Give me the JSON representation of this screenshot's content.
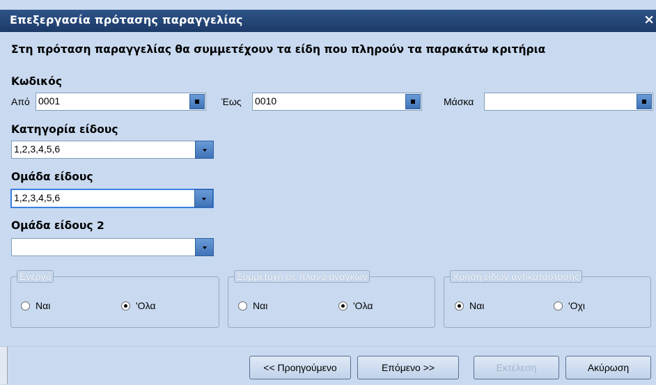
{
  "window": {
    "title": "Επεξεργασία πρότασης παραγγελίας",
    "close_glyph": "×"
  },
  "heading": "Στη πρόταση παραγγελίας θα συμμετέχουν τα είδη που πληρούν τα παρακάτω κριτήρια",
  "code": {
    "label": "Κωδικός",
    "from_label": "Από",
    "from_value": "0001",
    "to_label": "Έως",
    "to_value": "0010",
    "mask_label": "Μάσκα",
    "mask_value": ""
  },
  "category": {
    "label": "Κατηγορία είδους",
    "value": "1,2,3,4,5,6"
  },
  "group": {
    "label": "Ομάδα είδους",
    "value": "1,2,3,4,5,6"
  },
  "group2": {
    "label": "Ομάδα είδους 2",
    "value": ""
  },
  "active": {
    "legend": "Ενεργό",
    "options": [
      "Ναι",
      "'Ολα"
    ],
    "selected": 1
  },
  "needs_plan": {
    "legend": "Συμμετοχή σε πλάνο αναγκών",
    "options": [
      "Ναι",
      "'Ολα"
    ],
    "selected": 1
  },
  "replacement": {
    "legend": "Χρήση ειδών αντικατάστασης",
    "options": [
      "Ναι",
      "'Οχι"
    ],
    "selected": 0
  },
  "buttons": {
    "previous": "<< Προηγούμενο",
    "next": "Επόμενο >>",
    "execute": "Εκτέλεση",
    "cancel": "Ακύρωση"
  }
}
